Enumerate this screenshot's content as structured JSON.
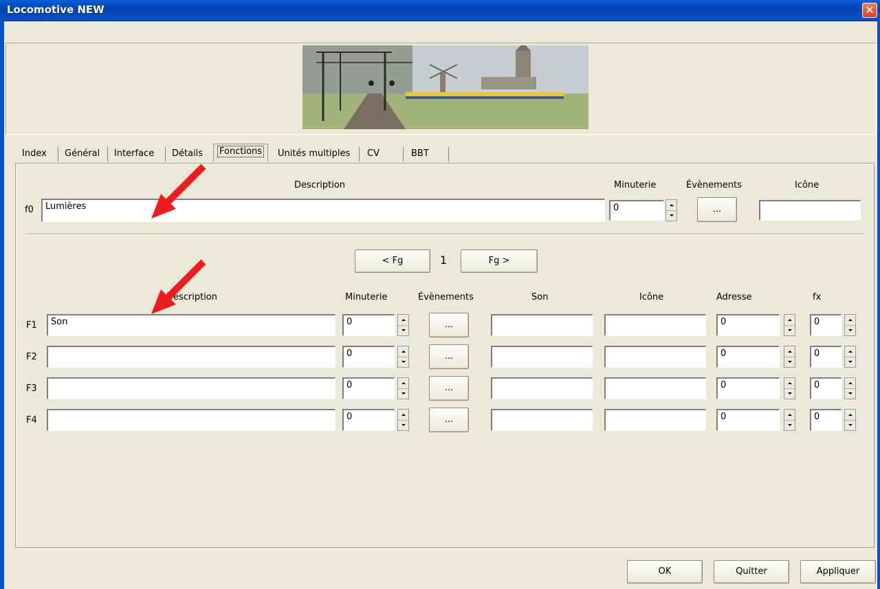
{
  "window": {
    "title": "Locomotive NEW",
    "close_glyph": "✕"
  },
  "tabs": [
    "Index",
    "Général",
    "Interface",
    "Détails",
    "Fonctions",
    "Unités multiples",
    "CV",
    "BBT"
  ],
  "active_tab": "Fonctions",
  "f0": {
    "col_description": "Description",
    "col_minuterie": "Minuterie",
    "col_evenements": "Évènements",
    "col_icone": "Icône",
    "label": "f0",
    "description": "Lumières",
    "minuterie": "0",
    "events_button": "...",
    "icone": ""
  },
  "pager": {
    "prev": "< Fg",
    "page": "1",
    "next": "Fg >"
  },
  "functions_header": {
    "description": "Description",
    "minuterie": "Minuterie",
    "evenements": "Évènements",
    "son": "Son",
    "icone": "Icône",
    "adresse": "Adresse",
    "fx": "fx"
  },
  "functions": [
    {
      "label": "F1",
      "description": "Son",
      "minuterie": "0",
      "events": "...",
      "son": "",
      "icone": "",
      "adresse": "0",
      "fx": "0"
    },
    {
      "label": "F2",
      "description": "",
      "minuterie": "0",
      "events": "...",
      "son": "",
      "icone": "",
      "adresse": "0",
      "fx": "0"
    },
    {
      "label": "F3",
      "description": "",
      "minuterie": "0",
      "events": "...",
      "son": "",
      "icone": "",
      "adresse": "0",
      "fx": "0"
    },
    {
      "label": "F4",
      "description": "",
      "minuterie": "0",
      "events": "...",
      "son": "",
      "icone": "",
      "adresse": "0",
      "fx": "0"
    }
  ],
  "footer": {
    "ok": "OK",
    "quit": "Quitter",
    "apply": "Appliquer"
  },
  "colors": {
    "titlebar": "#0342b5",
    "dialog_bg": "#ece9d8",
    "annotation_arrow": "#ee1c1c"
  }
}
